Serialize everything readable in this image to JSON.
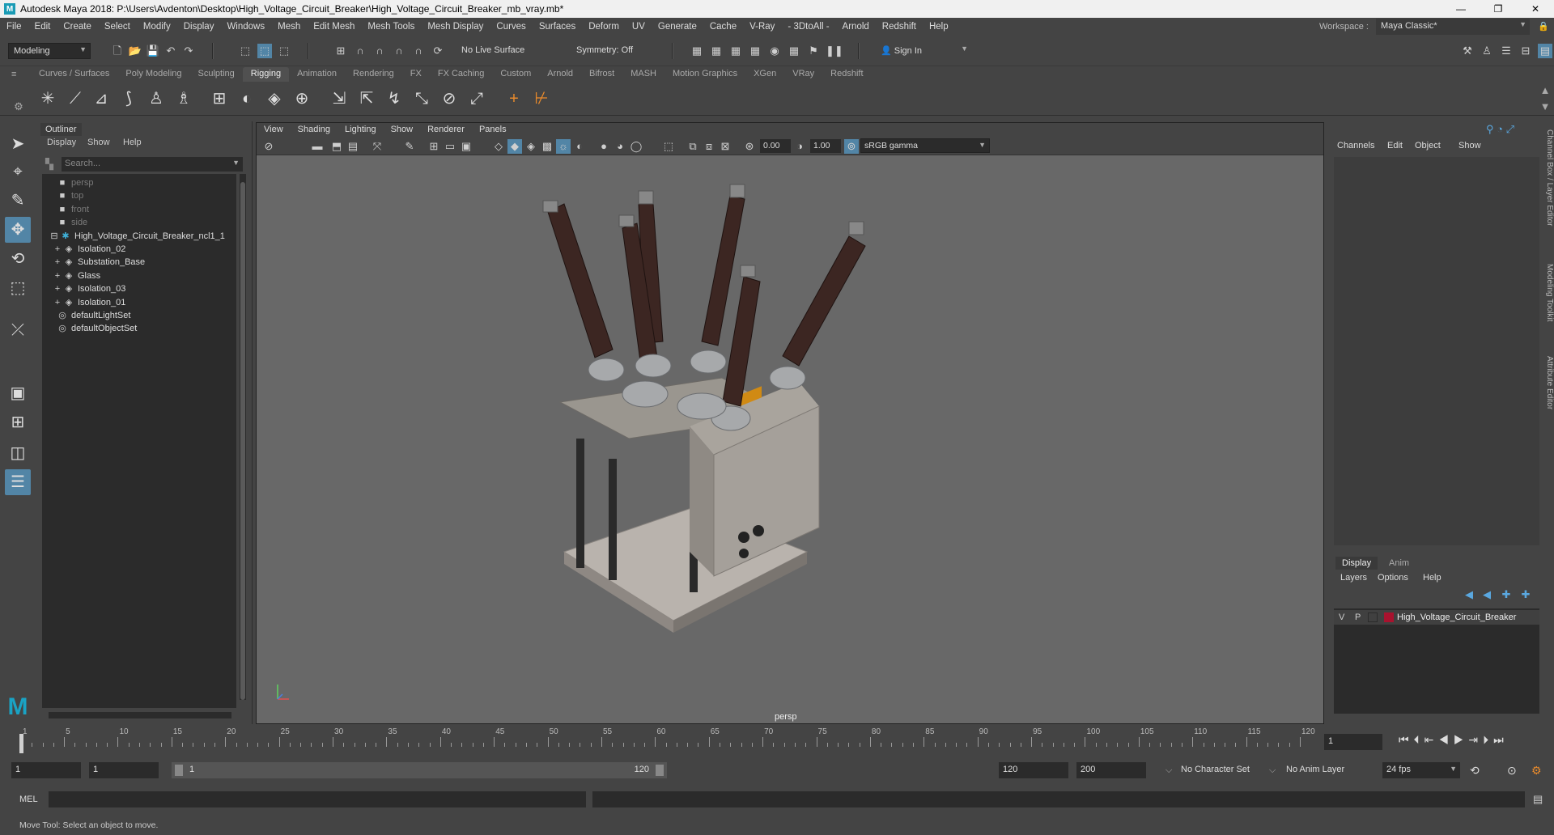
{
  "window": {
    "title": "Autodesk Maya 2018: P:\\Users\\Avdenton\\Desktop\\High_Voltage_Circuit_Breaker\\High_Voltage_Circuit_Breaker_mb_vray.mb*",
    "app_icon": "M",
    "minimize": "—",
    "maximize": "❐",
    "close": "✕"
  },
  "menubar": {
    "items": [
      "File",
      "Edit",
      "Create",
      "Select",
      "Modify",
      "Display",
      "Windows",
      "Mesh",
      "Edit Mesh",
      "Mesh Tools",
      "Mesh Display",
      "Curves",
      "Surfaces",
      "Deform",
      "UV",
      "Generate",
      "Cache",
      "V-Ray",
      "- 3DtoAll -",
      "Arnold",
      "Redshift",
      "Help"
    ],
    "workspace_label": "Workspace :",
    "workspace_value": "Maya Classic*"
  },
  "statusline": {
    "mode": "Modeling",
    "live_surface": "No Live Surface",
    "symmetry": "Symmetry: Off",
    "sign_in": "Sign In"
  },
  "shelf": {
    "tabs": [
      "Curves / Surfaces",
      "Poly Modeling",
      "Sculpting",
      "Rigging",
      "Animation",
      "Rendering",
      "FX",
      "FX Caching",
      "Custom",
      "Arnold",
      "Bifrost",
      "MASH",
      "Motion Graphics",
      "XGen",
      "VRay",
      "Redshift"
    ],
    "active_tab": "Rigging"
  },
  "outliner": {
    "title": "Outliner",
    "menu": [
      "Display",
      "Show",
      "Help"
    ],
    "search_placeholder": "Search...",
    "items": [
      {
        "label": "persp",
        "dim": true,
        "indent": 1,
        "icon": "camera-icon"
      },
      {
        "label": "top",
        "dim": true,
        "indent": 1,
        "icon": "camera-icon"
      },
      {
        "label": "front",
        "dim": true,
        "indent": 1,
        "icon": "camera-icon"
      },
      {
        "label": "side",
        "dim": true,
        "indent": 1,
        "icon": "camera-icon"
      },
      {
        "label": "High_Voltage_Circuit_Breaker_ncl1_1",
        "dim": false,
        "indent": 0,
        "icon": "group-icon"
      },
      {
        "label": "Isolation_02",
        "dim": false,
        "indent": 2,
        "icon": "mesh-icon"
      },
      {
        "label": "Substation_Base",
        "dim": false,
        "indent": 2,
        "icon": "mesh-icon"
      },
      {
        "label": "Glass",
        "dim": false,
        "indent": 2,
        "icon": "mesh-icon"
      },
      {
        "label": "Isolation_03",
        "dim": false,
        "indent": 2,
        "icon": "mesh-icon"
      },
      {
        "label": "Isolation_01",
        "dim": false,
        "indent": 2,
        "icon": "mesh-icon"
      },
      {
        "label": "defaultLightSet",
        "dim": false,
        "indent": 1,
        "icon": "set-icon"
      },
      {
        "label": "defaultObjectSet",
        "dim": false,
        "indent": 1,
        "icon": "set-icon"
      }
    ]
  },
  "viewport": {
    "menu": [
      "View",
      "Shading",
      "Lighting",
      "Show",
      "Renderer",
      "Panels"
    ],
    "exposure": "0.00",
    "gamma": "1.00",
    "color_space": "sRGB gamma",
    "camera_label": "persp"
  },
  "channelbox": {
    "menu": [
      "Channels",
      "Edit",
      "Object",
      "Show"
    ]
  },
  "layereditor": {
    "tabs": [
      "Display",
      "Anim"
    ],
    "active_tab": "Display",
    "menu": [
      "Layers",
      "Options",
      "Help"
    ],
    "layer": {
      "v": "V",
      "p": "P",
      "name": "High_Voltage_Circuit_Breaker",
      "color": "#a8122e"
    }
  },
  "side_tabs": [
    "Channel Box / Layer Editor",
    "Modeling Toolkit",
    "Attribute Editor"
  ],
  "timeline": {
    "ticks": [
      1,
      5,
      10,
      15,
      20,
      25,
      30,
      35,
      40,
      45,
      50,
      55,
      60,
      65,
      70,
      75,
      80,
      85,
      90,
      95,
      100,
      105,
      110,
      115,
      120
    ],
    "current_frame": "1"
  },
  "range": {
    "start": "1",
    "playback_start": "1",
    "slider_start": "1",
    "slider_end": "120",
    "playback_end": "120",
    "end": "200",
    "character_set": "No Character Set",
    "anim_layer": "No Anim Layer",
    "fps": "24 fps"
  },
  "commandline": {
    "label": "MEL"
  },
  "helpline": {
    "text": "Move Tool: Select an object to move."
  },
  "colors": {
    "accent": "#5285a6",
    "panel": "#444444",
    "viewport_bg": "#686868"
  }
}
